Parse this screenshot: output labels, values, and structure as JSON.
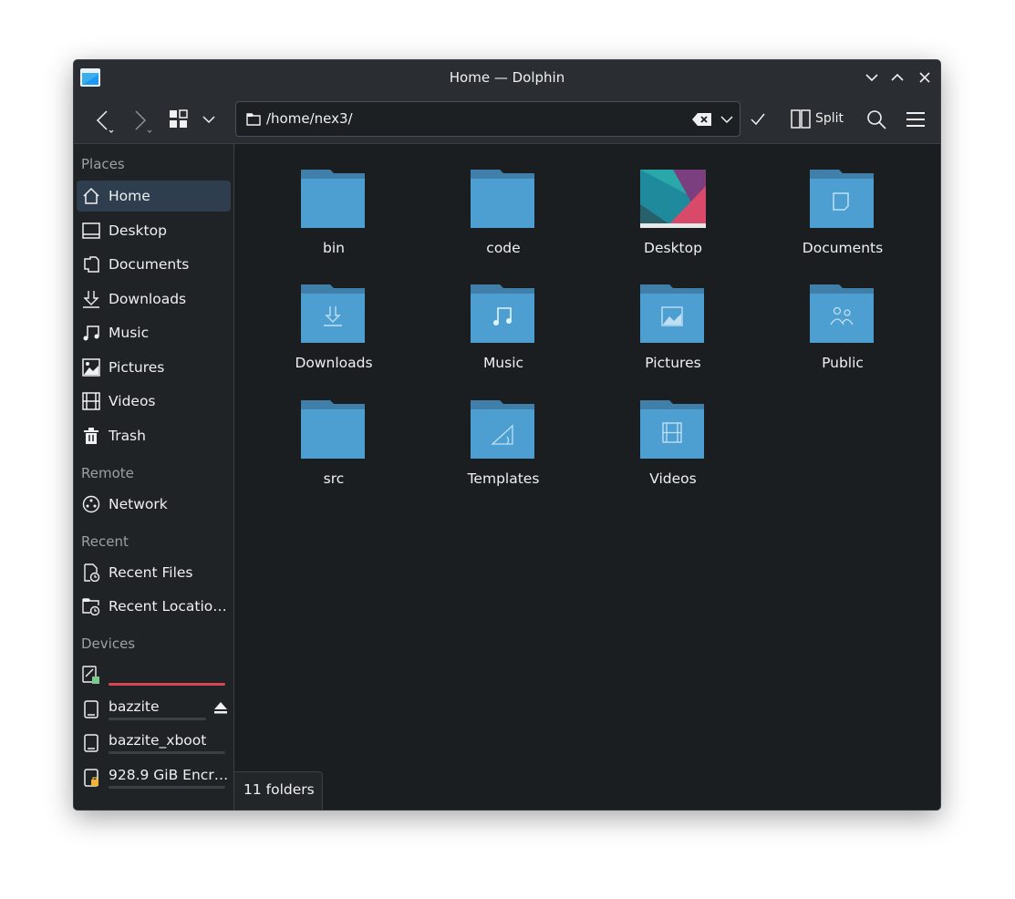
{
  "window": {
    "title": "Home — Dolphin"
  },
  "toolbar": {
    "path": "/home/nex3/",
    "split_label": "Split"
  },
  "sidebar": {
    "sections": {
      "places": "Places",
      "remote": "Remote",
      "recent": "Recent",
      "devices": "Devices"
    },
    "places": [
      {
        "label": "Home",
        "icon": "home-icon"
      },
      {
        "label": "Desktop",
        "icon": "desktop-icon"
      },
      {
        "label": "Documents",
        "icon": "documents-icon"
      },
      {
        "label": "Downloads",
        "icon": "downloads-icon"
      },
      {
        "label": "Music",
        "icon": "music-icon"
      },
      {
        "label": "Pictures",
        "icon": "pictures-icon"
      },
      {
        "label": "Videos",
        "icon": "videos-icon"
      },
      {
        "label": "Trash",
        "icon": "trash-icon"
      }
    ],
    "remote": [
      {
        "label": "Network",
        "icon": "network-icon"
      }
    ],
    "recent": [
      {
        "label": "Recent Files",
        "icon": "recent-files-icon"
      },
      {
        "label": "Recent Locatio…",
        "icon": "recent-locations-icon"
      }
    ],
    "devices": [
      {
        "label": "",
        "icon": "drive-icon"
      },
      {
        "label": "bazzite",
        "icon": "drive-icon"
      },
      {
        "label": "bazzite_xboot",
        "icon": "drive-icon"
      },
      {
        "label": "928.9 GiB Encr…",
        "icon": "encrypted-drive-icon"
      }
    ]
  },
  "folders": [
    {
      "name": "bin"
    },
    {
      "name": "code"
    },
    {
      "name": "Desktop"
    },
    {
      "name": "Documents"
    },
    {
      "name": "Downloads"
    },
    {
      "name": "Music"
    },
    {
      "name": "Pictures"
    },
    {
      "name": "Public"
    },
    {
      "name": "src"
    },
    {
      "name": "Templates"
    },
    {
      "name": "Videos"
    }
  ],
  "status": {
    "text": "11 folders"
  },
  "colors": {
    "accent": "#3daee9",
    "folder": "#4e9fd1",
    "folder_tab": "#3f7faa",
    "selection": "#2f3e4e",
    "danger": "#da4453"
  }
}
